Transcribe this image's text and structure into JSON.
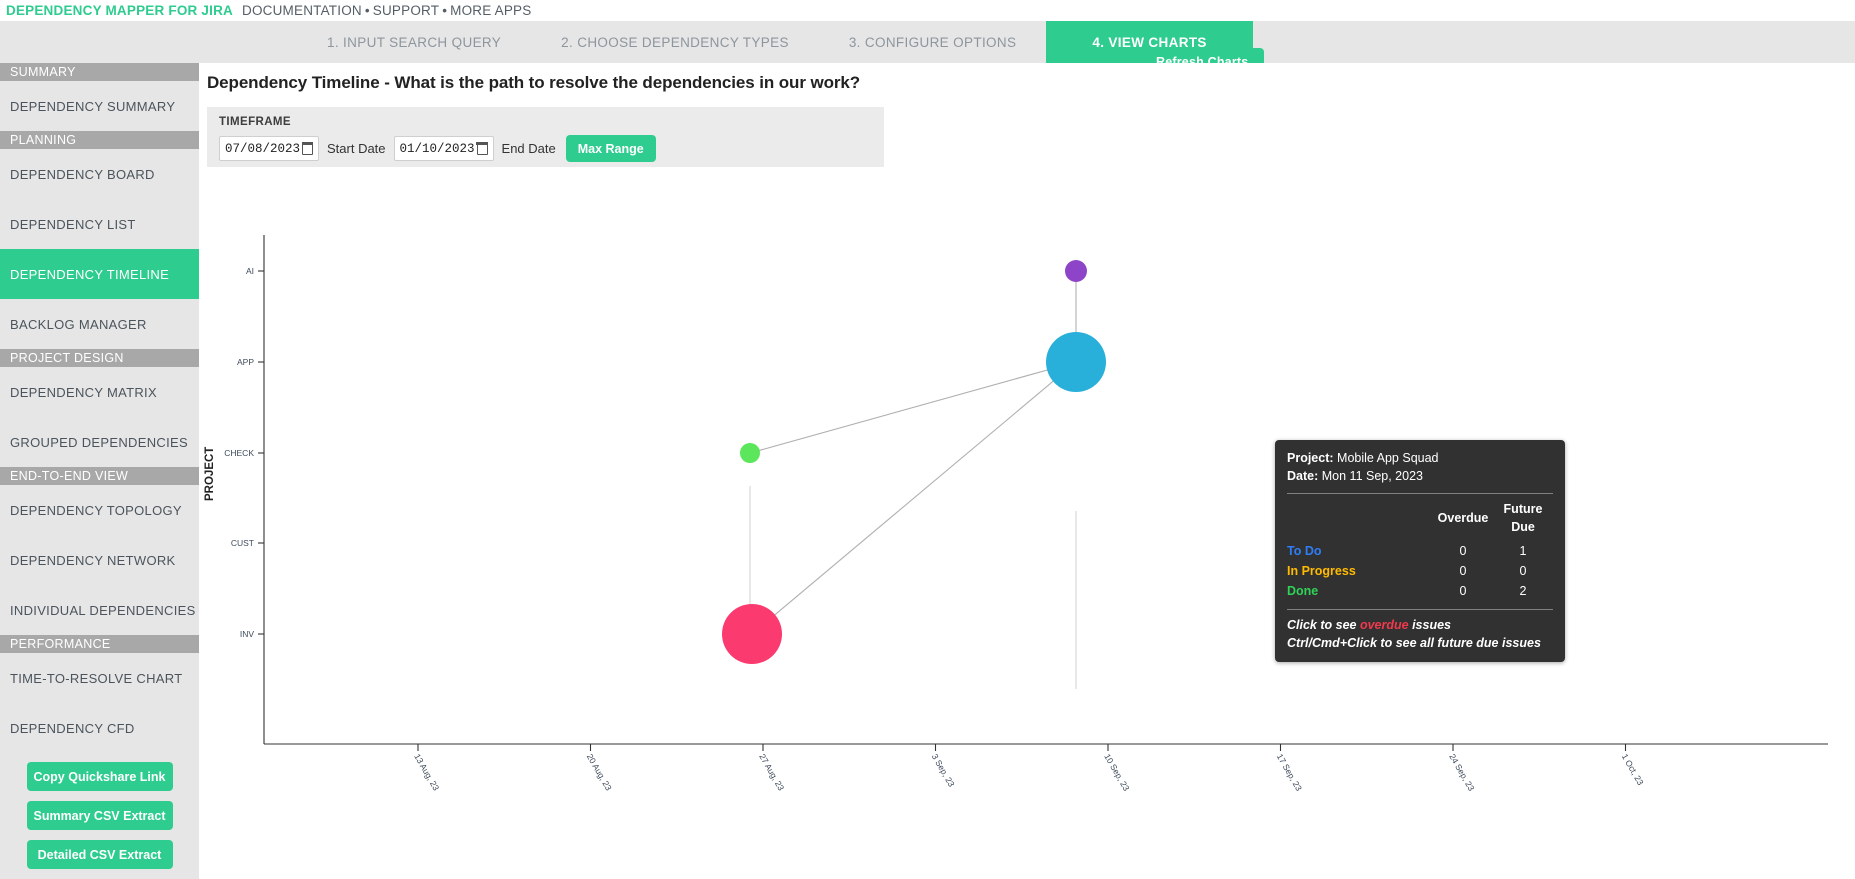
{
  "brand": {
    "name": "DEPENDENCY MAPPER FOR JIRA",
    "links": [
      "DOCUMENTATION",
      "SUPPORT",
      "MORE APPS"
    ],
    "separator": "•"
  },
  "stepnav": {
    "steps": [
      {
        "label": "1. INPUT SEARCH QUERY",
        "active": false
      },
      {
        "label": "2. CHOOSE DEPENDENCY TYPES",
        "active": false
      },
      {
        "label": "3. CONFIGURE OPTIONS",
        "active": false
      },
      {
        "label": "4. VIEW CHARTS",
        "active": true
      }
    ],
    "refresh_label": "Refresh Charts"
  },
  "sidebar": {
    "groups": [
      {
        "header": "SUMMARY",
        "items": [
          {
            "label": "DEPENDENCY SUMMARY",
            "active": false
          }
        ]
      },
      {
        "header": "PLANNING",
        "items": [
          {
            "label": "DEPENDENCY BOARD",
            "active": false
          },
          {
            "label": "DEPENDENCY LIST",
            "active": false
          },
          {
            "label": "DEPENDENCY TIMELINE",
            "active": true
          },
          {
            "label": "BACKLOG MANAGER",
            "active": false
          }
        ]
      },
      {
        "header": "PROJECT DESIGN",
        "items": [
          {
            "label": "DEPENDENCY MATRIX",
            "active": false
          },
          {
            "label": "GROUPED DEPENDENCIES",
            "active": false
          }
        ]
      },
      {
        "header": "END-TO-END VIEW",
        "items": [
          {
            "label": "DEPENDENCY TOPOLOGY",
            "active": false
          },
          {
            "label": "DEPENDENCY NETWORK",
            "active": false
          },
          {
            "label": "INDIVIDUAL DEPENDENCIES",
            "active": false
          }
        ]
      },
      {
        "header": "PERFORMANCE",
        "items": [
          {
            "label": "TIME-TO-RESOLVE CHART",
            "active": false
          },
          {
            "label": "DEPENDENCY CFD",
            "active": false
          }
        ]
      }
    ],
    "buttons": [
      {
        "label": "Copy Quickshare Link"
      },
      {
        "label": "Summary CSV Extract"
      },
      {
        "label": "Detailed CSV Extract"
      }
    ]
  },
  "main": {
    "page_title": "Dependency Timeline - What is the path to resolve the dependencies in our work?",
    "timeframe": {
      "legend": "TIMEFRAME",
      "start_value": "07/08/2023",
      "start_label": "Start Date",
      "end_value": "01/10/2023",
      "end_label": "End Date",
      "max_range_label": "Max Range"
    }
  },
  "tooltip": {
    "project_label": "Project:",
    "project_value": "Mobile App Squad",
    "date_label": "Date:",
    "date_value": "Mon 11 Sep, 2023",
    "col_overdue": "Overdue",
    "col_future": "Future Due",
    "rows": [
      {
        "status": "To Do",
        "overdue": "0",
        "future": "1",
        "color": "#2f7df6"
      },
      {
        "status": "In Progress",
        "overdue": "0",
        "future": "0",
        "color": "#ffbb00"
      },
      {
        "status": "Done",
        "overdue": "0",
        "future": "2",
        "color": "#30d158"
      }
    ],
    "foot_line1_pre": "Click to see ",
    "foot_line1_em": "overdue",
    "foot_line1_post": " issues",
    "foot_line2": "Ctrl/Cmd+Click to see all future due issues"
  },
  "chart_data": {
    "type": "scatter",
    "title": "Dependency Timeline - What is the path to resolve the dependencies in our work?",
    "xlabel": "",
    "ylabel": "PROJECT",
    "grid": false,
    "legend": null,
    "x_ticks": [
      "13 Aug, 23",
      "20 Aug, 23",
      "27 Aug, 23",
      "3 Sep, 23",
      "10 Sep, 23",
      "17 Sep, 23",
      "24 Sep, 23",
      "1 Oct, 23"
    ],
    "y_ticks": [
      "AI",
      "APP",
      "CHECK",
      "CUST",
      "INV"
    ],
    "points": [
      {
        "label": "AI",
        "x": "11 Sep, 23",
        "y": "AI",
        "size": 11,
        "color": "#8e44c9"
      },
      {
        "label": "APP",
        "x": "11 Sep, 23",
        "y": "APP",
        "size": 30,
        "color": "#29b0da"
      },
      {
        "label": "CHECK",
        "x": "29 Aug, 23",
        "y": "CHECK",
        "size": 10,
        "color": "#5ce65c"
      },
      {
        "label": "INV",
        "x": "28 Aug, 23",
        "y": "INV",
        "size": 30,
        "color": "#fb3b6f"
      }
    ],
    "links": [
      {
        "from": "AI",
        "to": "APP"
      },
      {
        "from": "CHECK",
        "to": "APP"
      },
      {
        "from": "INV",
        "to": "APP"
      }
    ]
  }
}
